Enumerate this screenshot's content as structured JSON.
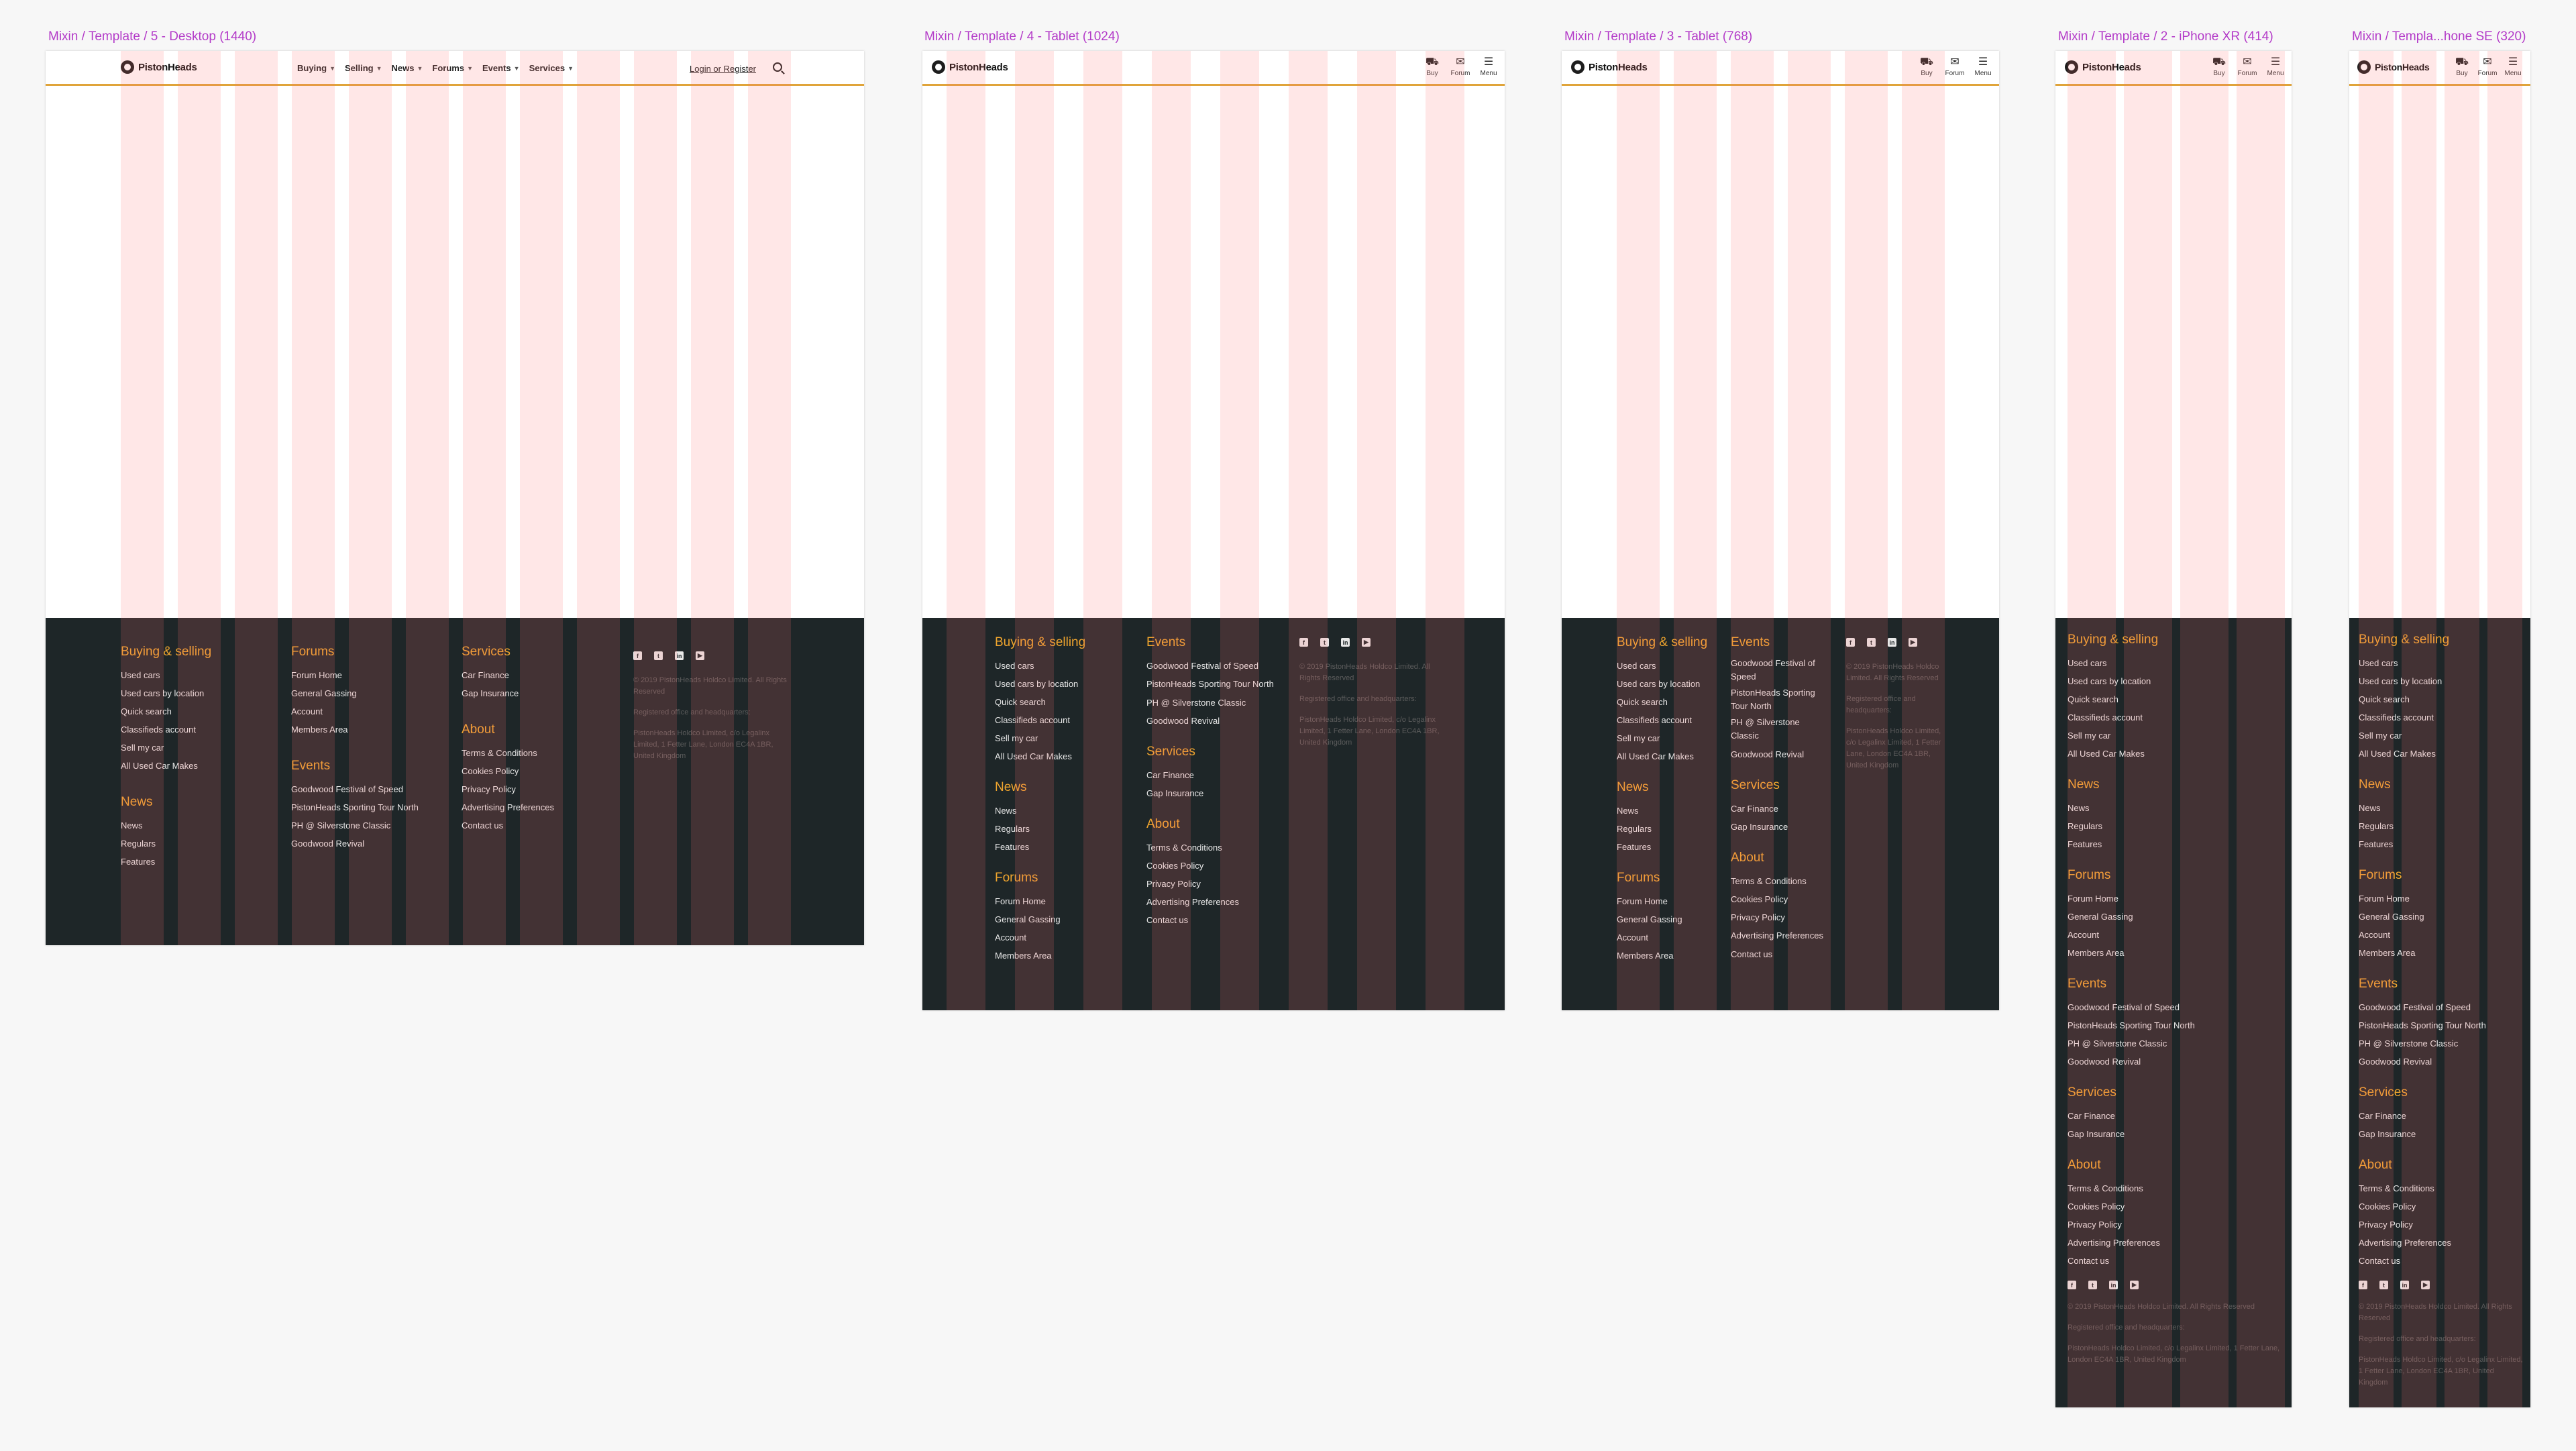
{
  "frames": {
    "desktop": "Mixin / Template / 5 - Desktop (1440)",
    "tablet1024": "Mixin / Template / 4 - Tablet (1024)",
    "tablet768": "Mixin / Template / 3 - Tablet (768)",
    "iphonexr": "Mixin / Template / 2 - iPhone XR (414)",
    "iphonese": "Mixin / Templa...hone SE (320)"
  },
  "brand": {
    "name": "PistonHeads",
    "accent": "#f0a52e",
    "footer_bg": "#1e2628",
    "column_tint": "#ffe3e3"
  },
  "nav": [
    {
      "label": "Buying",
      "icon": "chevron-down-icon"
    },
    {
      "label": "Selling",
      "icon": "chevron-down-icon"
    },
    {
      "label": "News",
      "icon": "chevron-down-icon"
    },
    {
      "label": "Forums",
      "icon": "chevron-down-icon"
    },
    {
      "label": "Events",
      "icon": "chevron-down-icon"
    },
    {
      "label": "Services",
      "icon": "chevron-down-icon"
    }
  ],
  "login": "Login or Register",
  "header_icons": {
    "buy": "Buy",
    "forum": "Forum",
    "menu": "Menu"
  },
  "footer": {
    "buying": {
      "heading": "Buying & selling",
      "links": [
        "Used cars",
        "Used cars by location",
        "Quick search",
        "Classifieds account",
        "Sell my car",
        "All Used Car Makes"
      ]
    },
    "news": {
      "heading": "News",
      "links": [
        "News",
        "Regulars",
        "Features"
      ]
    },
    "forums": {
      "heading": "Forums",
      "links": [
        "Forum Home",
        "General Gassing",
        "Account",
        "Members Area"
      ]
    },
    "events": {
      "heading": "Events",
      "links": [
        "Goodwood Festival of Speed",
        "PistonHeads Sporting Tour North",
        "PH @ Silverstone Classic",
        "Goodwood Revival"
      ]
    },
    "services": {
      "heading": "Services",
      "links": [
        "Car Finance",
        "Gap Insurance"
      ]
    },
    "about": {
      "heading": "About",
      "links": [
        "Terms & Conditions",
        "Cookies Policy",
        "Privacy Policy",
        "Advertising Preferences",
        "Contact us"
      ]
    },
    "social": [
      "facebook-icon",
      "twitter-icon",
      "linkedin-icon",
      "youtube-icon"
    ],
    "legal": [
      "© 2019 PistonHeads Holdco Limited. All Rights Reserved",
      "Registered office and headquarters:",
      "PistonHeads Holdco Limited, c/o Legalinx Limited, 1 Fetter Lane, London EC4A 1BR, United Kingdom"
    ]
  }
}
